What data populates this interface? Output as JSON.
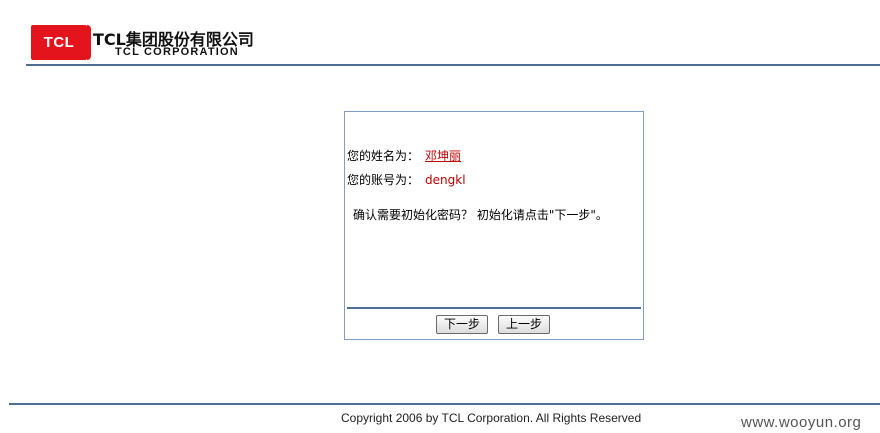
{
  "header": {
    "logo_text": "TCL",
    "company_cn": "TCL集团股份有限公司",
    "company_en": "TCL CORPORATION"
  },
  "dialog": {
    "name_label": "您的姓名为：",
    "name_value": "邓坤丽",
    "account_label": "您的账号为：",
    "account_value": "dengkl",
    "confirm_text": "确认需要初始化密码？ 初始化请点击\"下一步\"。",
    "next_button": "下一步",
    "prev_button": "上一步"
  },
  "footer": {
    "copyright": "Copyright 2006 by TCL Corporation. All Rights Reserved",
    "watermark": "www.wooyun.org"
  },
  "colors": {
    "brand_red": "#e3141c",
    "rule_blue": "#4d6f93",
    "value_red": "#c00000"
  }
}
